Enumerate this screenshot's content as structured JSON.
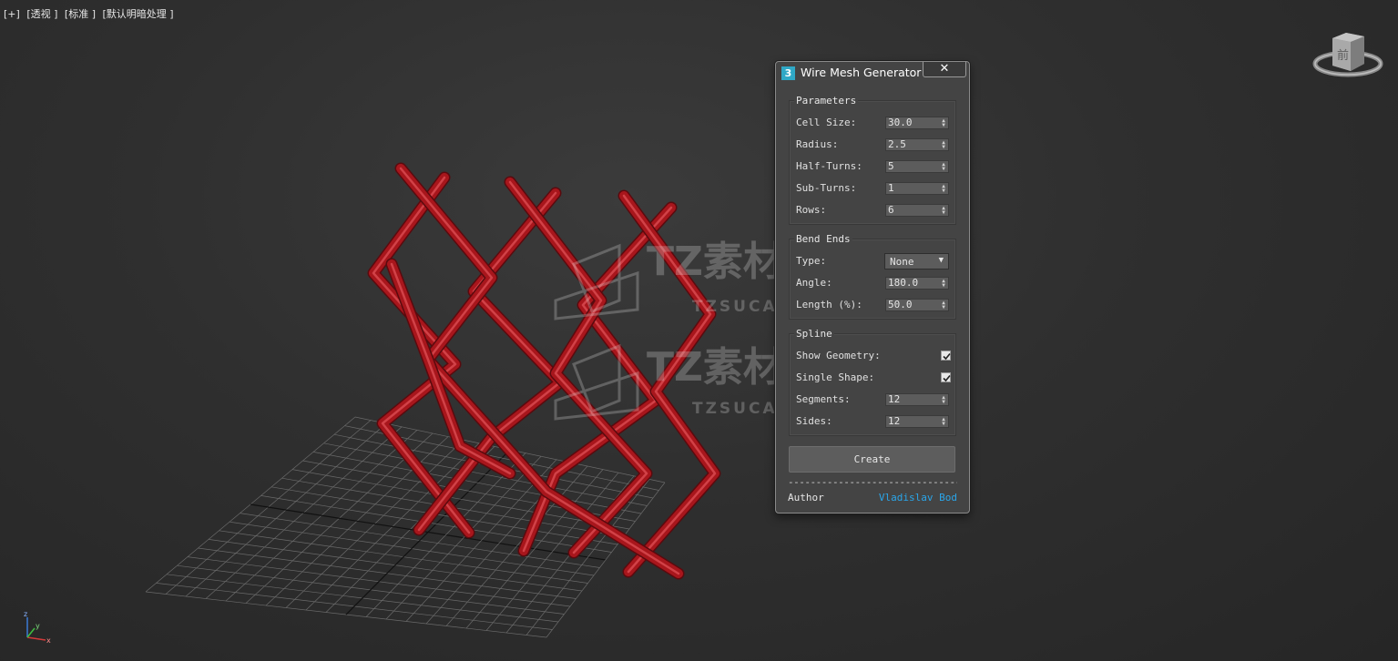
{
  "viewport": {
    "labels": [
      "[+]",
      "[透视 ]",
      "[标准 ]",
      "[默认明暗处理 ]"
    ],
    "viewcube_face": "前",
    "axis": {
      "z": "z",
      "y": "y",
      "x": "x"
    }
  },
  "watermark": {
    "brand": "TZ素材网",
    "domain": "TZSUCAI.COM"
  },
  "dialog": {
    "icon_text": "3",
    "title": "Wire Mesh Generator",
    "close_label": "✕",
    "parameters": {
      "title": "Parameters",
      "cell_size": {
        "label": "Cell Size:",
        "value": "30.0"
      },
      "radius": {
        "label": "Radius:",
        "value": "2.5"
      },
      "half_turns": {
        "label": "Half-Turns:",
        "value": "5"
      },
      "sub_turns": {
        "label": "Sub-Turns:",
        "value": "1"
      },
      "rows": {
        "label": "Rows:",
        "value": "6"
      }
    },
    "bend_ends": {
      "title": "Bend Ends",
      "type": {
        "label": "Type:",
        "value": "None"
      },
      "angle": {
        "label": "Angle:",
        "value": "180.0"
      },
      "length": {
        "label": "Length (%):",
        "value": "50.0"
      }
    },
    "spline": {
      "title": "Spline",
      "show_geometry": {
        "label": "Show Geometry:",
        "checked": true
      },
      "single_shape": {
        "label": "Single Shape:",
        "checked": true
      },
      "segments": {
        "label": "Segments:",
        "value": "12"
      },
      "sides": {
        "label": "Sides:",
        "value": "12"
      }
    },
    "create_label": "Create",
    "separator": "---------------------------------",
    "author_label": "Author",
    "author_name": "Vladislav Bod"
  },
  "colors": {
    "wire": "#a8161c",
    "wire_highlight": "#e2545a",
    "link": "#2aa6ea",
    "dialog_bg": "#444444"
  }
}
